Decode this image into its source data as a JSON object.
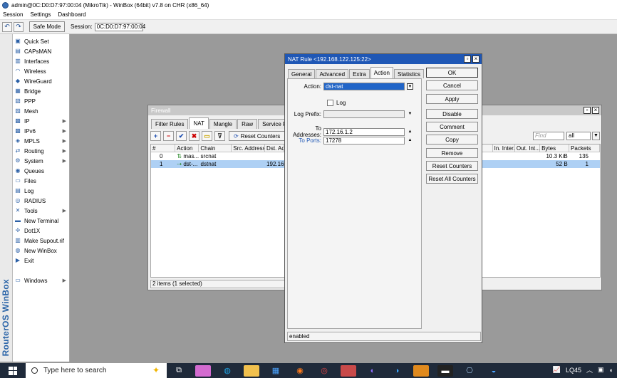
{
  "window": {
    "title": "admin@0C:D0:D7:97:00:04 (MikroTik) - WinBox (64bit) v7.8 on CHR (x86_64)"
  },
  "menu": [
    "Session",
    "Settings",
    "Dashboard"
  ],
  "toolbar": {
    "safe_mode": "Safe Mode",
    "session_label": "Session:",
    "session_value": "0C:D0:D7:97:00:04"
  },
  "brand": "RouterOS WinBox",
  "sidebar": [
    {
      "label": "Quick Set",
      "icon": "quick-set-icon",
      "sub": false
    },
    {
      "label": "CAPsMAN",
      "icon": "capsman-icon",
      "sub": false
    },
    {
      "label": "Interfaces",
      "icon": "interfaces-icon",
      "sub": false
    },
    {
      "label": "Wireless",
      "icon": "wireless-icon",
      "sub": false
    },
    {
      "label": "WireGuard",
      "icon": "wireguard-icon",
      "sub": false
    },
    {
      "label": "Bridge",
      "icon": "bridge-icon",
      "sub": false
    },
    {
      "label": "PPP",
      "icon": "ppp-icon",
      "sub": false
    },
    {
      "label": "Mesh",
      "icon": "mesh-icon",
      "sub": false
    },
    {
      "label": "IP",
      "icon": "ip-icon",
      "sub": true
    },
    {
      "label": "IPv6",
      "icon": "ipv6-icon",
      "sub": true
    },
    {
      "label": "MPLS",
      "icon": "mpls-icon",
      "sub": true
    },
    {
      "label": "Routing",
      "icon": "routing-icon",
      "sub": true
    },
    {
      "label": "System",
      "icon": "system-icon",
      "sub": true
    },
    {
      "label": "Queues",
      "icon": "queues-icon",
      "sub": false
    },
    {
      "label": "Files",
      "icon": "files-icon",
      "sub": false
    },
    {
      "label": "Log",
      "icon": "log-icon",
      "sub": false
    },
    {
      "label": "RADIUS",
      "icon": "radius-icon",
      "sub": false
    },
    {
      "label": "Tools",
      "icon": "tools-icon",
      "sub": true
    },
    {
      "label": "New Terminal",
      "icon": "terminal-icon",
      "sub": false
    },
    {
      "label": "Dot1X",
      "icon": "dot1x-icon",
      "sub": false
    },
    {
      "label": "Make Supout.rif",
      "icon": "supout-icon",
      "sub": false
    },
    {
      "label": "New WinBox",
      "icon": "winbox-icon",
      "sub": false
    },
    {
      "label": "Exit",
      "icon": "exit-icon",
      "sub": false
    }
  ],
  "sidebar_windows": {
    "label": "Windows",
    "icon": "windows-icon"
  },
  "firewall": {
    "title": "Firewall",
    "tabs": [
      "Filter Rules",
      "NAT",
      "Mangle",
      "Raw",
      "Service Ports"
    ],
    "active_tab": 1,
    "reset_counters": "Reset Counters",
    "find_placeholder": "Find",
    "filter_value": "all",
    "columns": [
      "#",
      "Action",
      "Chain",
      "Src. Address",
      "Dst. Ad",
      "In. Inter...",
      "Out. Int...",
      "Bytes",
      "Packets"
    ],
    "rows": [
      {
        "num": "0",
        "action": "mas...",
        "chain": "srcnat",
        "src": "",
        "dst": "",
        "in": "",
        "out": "",
        "bytes": "10.3 KiB",
        "packets": "135",
        "selected": false
      },
      {
        "num": "1",
        "action": "dst-...",
        "chain": "dstnat",
        "src": "",
        "dst": "192.16",
        "in": "",
        "out": "",
        "bytes": "52 B",
        "packets": "1",
        "selected": true
      }
    ],
    "status": "2 items (1 selected)"
  },
  "nat_dialog": {
    "title": "NAT Rule <192.168.122.125:22>",
    "tabs": [
      "General",
      "Advanced",
      "Extra",
      "Action",
      "Statistics"
    ],
    "active_tab": 3,
    "action_label": "Action:",
    "action_value": "dst-nat",
    "log_label": "Log",
    "log_prefix_label": "Log Prefix:",
    "to_addresses_label": "To Addresses:",
    "to_addresses_value": "172.16.1.2",
    "to_ports_label": "To Ports:",
    "to_ports_value": "17278",
    "buttons": [
      "OK",
      "Cancel",
      "Apply",
      "Disable",
      "Comment",
      "Copy",
      "Remove",
      "Reset Counters",
      "Reset All Counters"
    ],
    "status": "enabled"
  },
  "taskbar": {
    "search_placeholder": "Type here to search",
    "tray_text": "LQ45"
  }
}
